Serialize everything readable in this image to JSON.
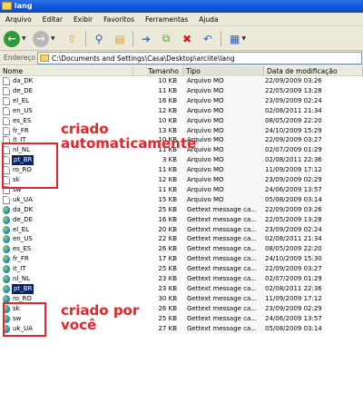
{
  "window": {
    "title": "lang"
  },
  "menu": [
    "Arquivo",
    "Editar",
    "Exibir",
    "Favoritos",
    "Ferramentas",
    "Ajuda"
  ],
  "toolbar": {
    "back_icon": "back-arrow-icon",
    "forward_icon": "forward-arrow-icon",
    "up_icon": "up-folder-icon",
    "search_icon": "search-icon",
    "folders_icon": "folders-icon",
    "move_icon": "move-to-icon",
    "copy_icon": "copy-to-icon",
    "delete_icon": "delete-icon",
    "undo_icon": "undo-icon",
    "views_icon": "views-icon"
  },
  "address": {
    "label": "Endereço",
    "value": "C:\\Documents and Settings\\Casa\\Desktop\\arclite\\lang"
  },
  "columns": {
    "name": "Nome",
    "size": "Tamanho",
    "type": "Tipo",
    "date": "Data de modificação"
  },
  "files": [
    {
      "name": "da_DK",
      "size": "10 KB",
      "type": "Arquivo MO",
      "date": "22/09/2009 03:26",
      "icon": "doc"
    },
    {
      "name": "de_DE",
      "size": "11 KB",
      "type": "Arquivo MO",
      "date": "22/05/2009 13:28",
      "icon": "doc"
    },
    {
      "name": "el_EL",
      "size": "16 KB",
      "type": "Arquivo MO",
      "date": "23/09/2009 02:24",
      "icon": "doc"
    },
    {
      "name": "en_US",
      "size": "12 KB",
      "type": "Arquivo MO",
      "date": "02/08/2011 21:34",
      "icon": "doc"
    },
    {
      "name": "es_ES",
      "size": "10 KB",
      "type": "Arquivo MO",
      "date": "08/05/2009 22:20",
      "icon": "doc"
    },
    {
      "name": "fr_FR",
      "size": "13 KB",
      "type": "Arquivo MO",
      "date": "24/10/2009 15:29",
      "icon": "doc"
    },
    {
      "name": "it_IT",
      "size": "10 KB",
      "type": "Arquivo MO",
      "date": "22/09/2009 03:27",
      "icon": "doc"
    },
    {
      "name": "nl_NL",
      "size": "11 KB",
      "type": "Arquivo MO",
      "date": "02/07/2009 01:29",
      "icon": "doc"
    },
    {
      "name": "pt_BR",
      "size": "3 KB",
      "type": "Arquivo MO",
      "date": "02/08/2011 22:36",
      "icon": "doc",
      "selected": true
    },
    {
      "name": "ro_RO",
      "size": "11 KB",
      "type": "Arquivo MO",
      "date": "11/09/2009 17:12",
      "icon": "doc"
    },
    {
      "name": "sk",
      "size": "12 KB",
      "type": "Arquivo MO",
      "date": "23/09/2009 02:29",
      "icon": "doc"
    },
    {
      "name": "sw",
      "size": "11 KB",
      "type": "Arquivo MO",
      "date": "24/06/2009 13:57",
      "icon": "doc"
    },
    {
      "name": "uk_UA",
      "size": "15 KB",
      "type": "Arquivo MO",
      "date": "05/08/2009 03:14",
      "icon": "doc"
    },
    {
      "name": "da_DK",
      "size": "25 KB",
      "type": "Gettext message ca...",
      "date": "22/09/2009 03:26",
      "icon": "globe"
    },
    {
      "name": "de_DE",
      "size": "16 KB",
      "type": "Gettext message ca...",
      "date": "22/05/2009 13:28",
      "icon": "globe"
    },
    {
      "name": "el_EL",
      "size": "20 KB",
      "type": "Gettext message ca...",
      "date": "23/09/2009 02:24",
      "icon": "globe"
    },
    {
      "name": "en_US",
      "size": "22 KB",
      "type": "Gettext message ca...",
      "date": "02/08/2011 21:34",
      "icon": "globe"
    },
    {
      "name": "es_ES",
      "size": "26 KB",
      "type": "Gettext message ca...",
      "date": "08/05/2009 22:20",
      "icon": "globe"
    },
    {
      "name": "fr_FR",
      "size": "17 KB",
      "type": "Gettext message ca...",
      "date": "24/10/2009 15:30",
      "icon": "globe"
    },
    {
      "name": "it_IT",
      "size": "25 KB",
      "type": "Gettext message ca...",
      "date": "22/09/2009 03:27",
      "icon": "globe"
    },
    {
      "name": "nl_NL",
      "size": "23 KB",
      "type": "Gettext message ca...",
      "date": "02/07/2009 01:29",
      "icon": "globe"
    },
    {
      "name": "pt_BR",
      "size": "23 KB",
      "type": "Gettext message ca...",
      "date": "02/08/2011 22:36",
      "icon": "globe",
      "selected": true
    },
    {
      "name": "ro_RO",
      "size": "30 KB",
      "type": "Gettext message ca...",
      "date": "11/09/2009 17:12",
      "icon": "globe"
    },
    {
      "name": "sk",
      "size": "26 KB",
      "type": "Gettext message ca...",
      "date": "23/09/2009 02:29",
      "icon": "globe"
    },
    {
      "name": "sw",
      "size": "25 KB",
      "type": "Gettext message ca...",
      "date": "24/06/2009 13:57",
      "icon": "globe"
    },
    {
      "name": "uk_UA",
      "size": "27 KB",
      "type": "Gettext message ca...",
      "date": "05/08/2009 03:14",
      "icon": "globe"
    }
  ],
  "annotations": {
    "auto_line1": "criado",
    "auto_line2": "automaticamente",
    "manual_line1": "criado por",
    "manual_line2": "você",
    "color": "#e3262c"
  }
}
